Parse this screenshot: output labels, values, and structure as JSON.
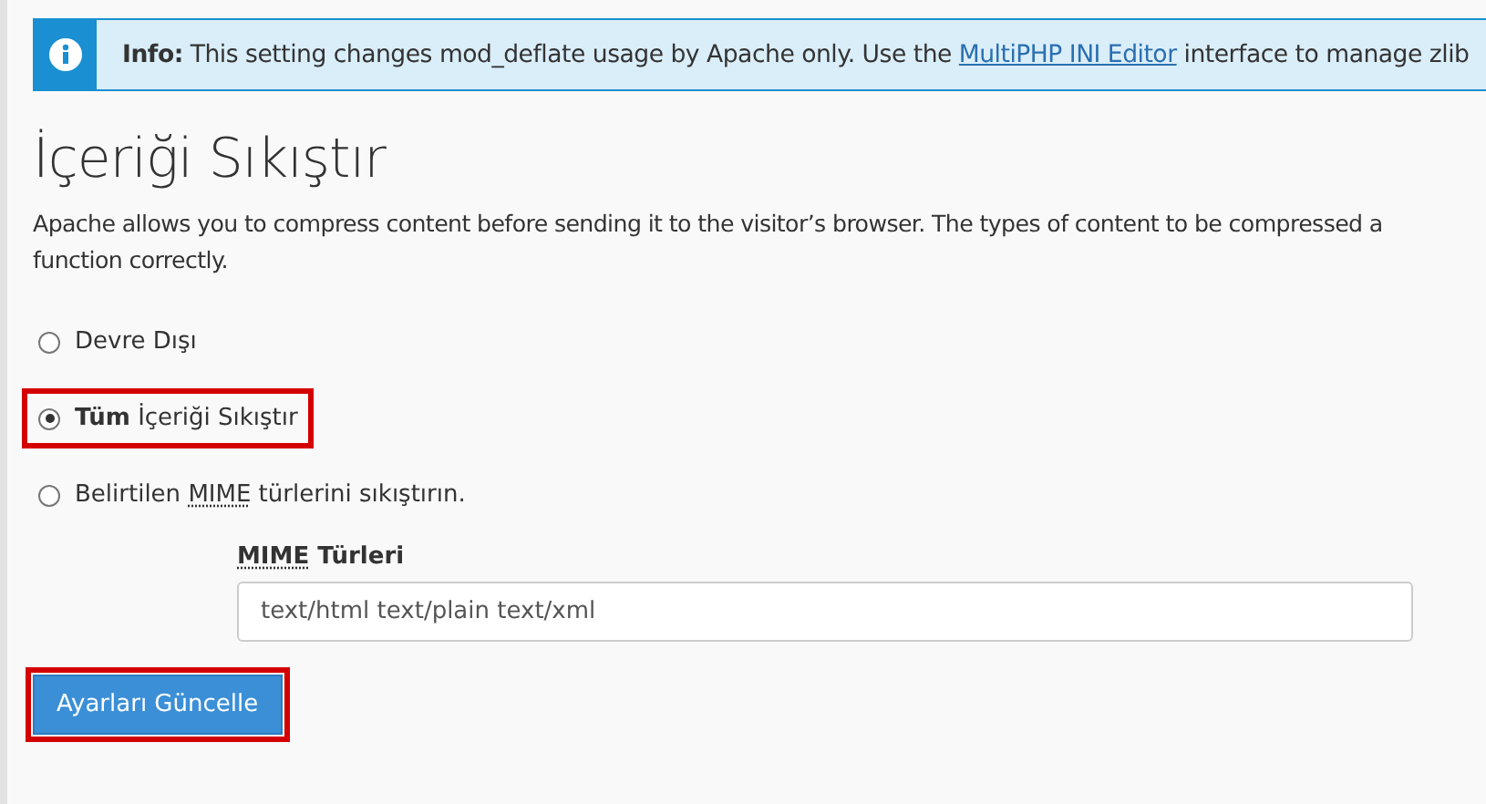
{
  "info": {
    "label": "Info:",
    "text_before": "This setting changes mod_deflate usage by Apache only. Use the",
    "link": "MultiPHP INI Editor",
    "text_after": "interface to manage zlib"
  },
  "title": "İçeriği Sıkıştır",
  "description": "Apache allows you to compress content before sending it to the visitor’s browser. The types of content to be compressed a function correctly.",
  "options": [
    {
      "parts": [
        {
          "t": "Devre Dışı"
        }
      ],
      "selected": false,
      "highlighted": false
    },
    {
      "parts": [
        {
          "t": "**Tüm** İçeriği Sıkıştır"
        }
      ],
      "selected": true,
      "highlighted": true
    },
    {
      "parts": [
        {
          "t": "Belirtilen "
        },
        {
          "t": "MIME",
          "abbr": true
        },
        {
          "t": " türlerini sıkıştırın."
        }
      ],
      "selected": false,
      "highlighted": false
    }
  ],
  "mime": {
    "label_parts": [
      {
        "t": "MIME",
        "abbr": true
      },
      {
        "t": " Türleri"
      }
    ],
    "value": "text/html text/plain text/xml"
  },
  "button": {
    "label": "Ayarları Güncelle",
    "highlighted": true
  }
}
